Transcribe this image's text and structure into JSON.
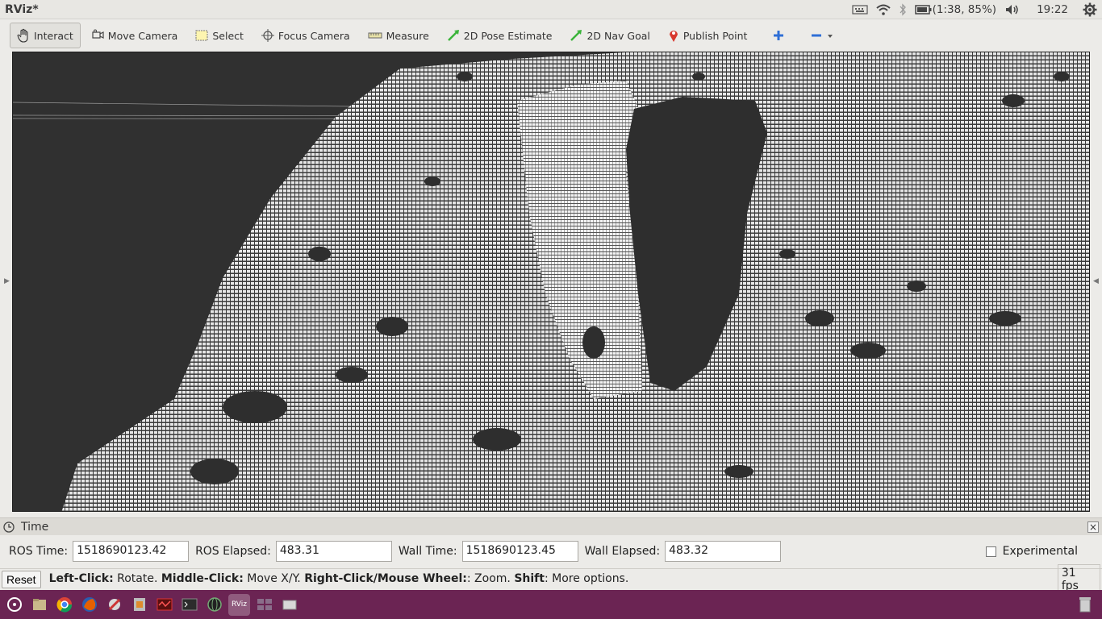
{
  "app": {
    "title": "RViz*"
  },
  "indicators": {
    "battery": "(1:38, 85%)",
    "clock": "19:22"
  },
  "toolbar": {
    "tools": [
      {
        "label": "Interact"
      },
      {
        "label": "Move Camera"
      },
      {
        "label": "Select"
      },
      {
        "label": "Focus Camera"
      },
      {
        "label": "Measure"
      },
      {
        "label": "2D Pose Estimate"
      },
      {
        "label": "2D Nav Goal"
      },
      {
        "label": "Publish Point"
      }
    ]
  },
  "time": {
    "panel_title": "Time",
    "ros_time_label": "ROS Time:",
    "ros_time_value": "1518690123.42",
    "ros_elapsed_label": "ROS Elapsed:",
    "ros_elapsed_value": "483.31",
    "wall_time_label": "Wall Time:",
    "wall_time_value": "1518690123.45",
    "wall_elapsed_label": "Wall Elapsed:",
    "wall_elapsed_value": "483.32",
    "experimental_label": "Experimental"
  },
  "status": {
    "reset_label": "Reset",
    "hint_a": "Left-Click:",
    "hint_b": " Rotate. ",
    "hint_c": "Middle-Click:",
    "hint_d": " Move X/Y. ",
    "hint_e": "Right-Click/Mouse Wheel:",
    "hint_f": ": Zoom. ",
    "hint_g": "Shift",
    "hint_h": ": More options.",
    "fps": "31 fps"
  },
  "colors": {
    "viewport_bg": "#303030",
    "points": "#e8e8e8",
    "taskbar": "#6b2453"
  }
}
